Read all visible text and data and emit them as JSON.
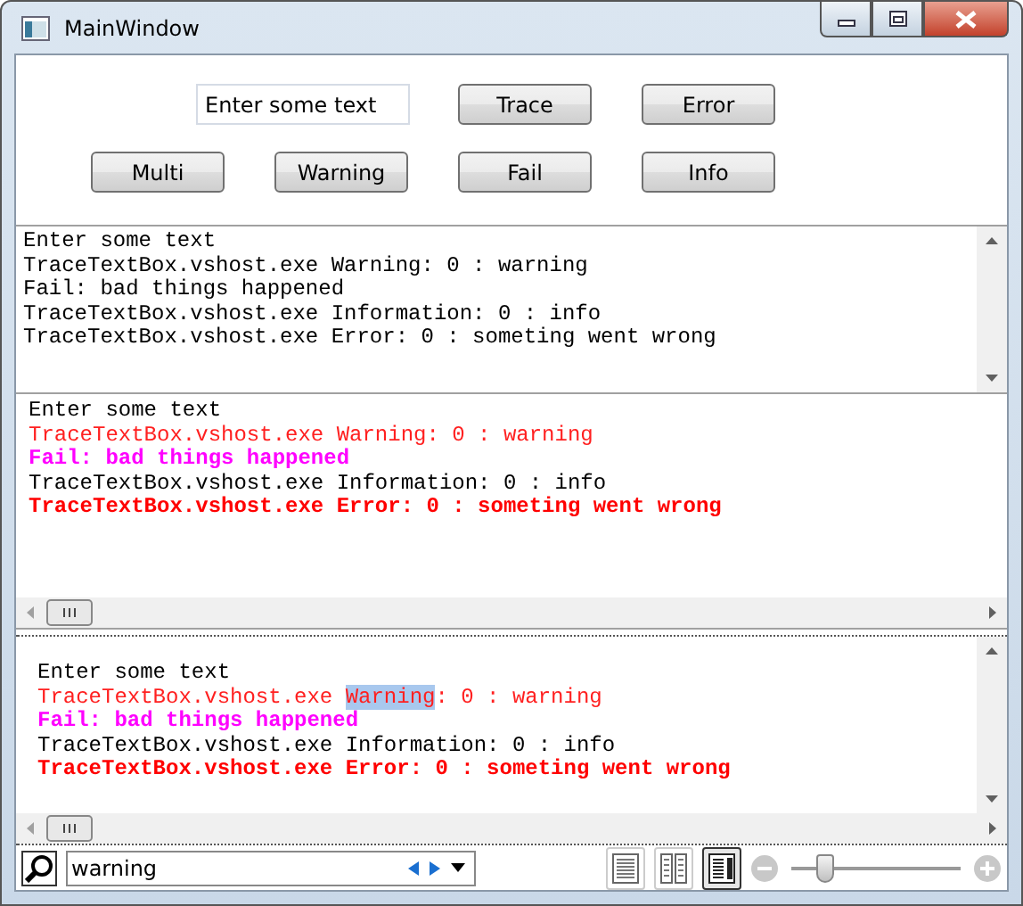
{
  "window": {
    "title": "MainWindow"
  },
  "input": {
    "value": "Enter some text"
  },
  "buttons": [
    "Trace",
    "Error",
    "Multi",
    "Warning",
    "Fail",
    "Info"
  ],
  "plain_log": {
    "lines": [
      "Enter some text",
      "TraceTextBox.vshost.exe Warning: 0 : warning",
      "Fail: bad things happened",
      "TraceTextBox.vshost.exe Information: 0 : info",
      "TraceTextBox.vshost.exe Error: 0 : someting went wrong"
    ]
  },
  "rich_log": {
    "lines": [
      {
        "kind": "plain",
        "segments": [
          {
            "text": "Enter some text",
            "highlighted": false
          }
        ]
      },
      {
        "kind": "warning",
        "segments": [
          {
            "text": "TraceTextBox.vshost.exe Warning: 0 : warning",
            "highlighted": false
          }
        ]
      },
      {
        "kind": "fail",
        "segments": [
          {
            "text": "Fail: bad things happened",
            "highlighted": false
          }
        ]
      },
      {
        "kind": "info",
        "segments": [
          {
            "text": "TraceTextBox.vshost.exe Information: 0 : info",
            "highlighted": false
          }
        ]
      },
      {
        "kind": "error",
        "segments": [
          {
            "text": "TraceTextBox.vshost.exe Error: 0 : someting went wrong",
            "highlighted": false
          }
        ]
      }
    ]
  },
  "document_log": {
    "lines": [
      {
        "kind": "plain",
        "segments": [
          {
            "text": "Enter some text",
            "highlighted": false
          }
        ]
      },
      {
        "kind": "warning",
        "segments": [
          {
            "text": "TraceTextBox.vshost.exe ",
            "highlighted": false
          },
          {
            "text": "Warning",
            "highlighted": true
          },
          {
            "text": ": 0 : warning",
            "highlighted": false
          }
        ]
      },
      {
        "kind": "fail",
        "segments": [
          {
            "text": "Fail: bad things happened",
            "highlighted": false
          }
        ]
      },
      {
        "kind": "info",
        "segments": [
          {
            "text": "TraceTextBox.vshost.exe Information: 0 : info",
            "highlighted": false
          }
        ]
      },
      {
        "kind": "error",
        "segments": [
          {
            "text": "TraceTextBox.vshost.exe Error: 0 : someting went wrong",
            "highlighted": false
          }
        ]
      }
    ]
  },
  "viewer_toolbar": {
    "search": {
      "value": "warning"
    },
    "view_modes": [
      {
        "kind": "page",
        "selected": false
      },
      {
        "kind": "two-page",
        "selected": false
      },
      {
        "kind": "scroll",
        "selected": true
      }
    ],
    "zoom": {
      "level": 0.2
    }
  }
}
